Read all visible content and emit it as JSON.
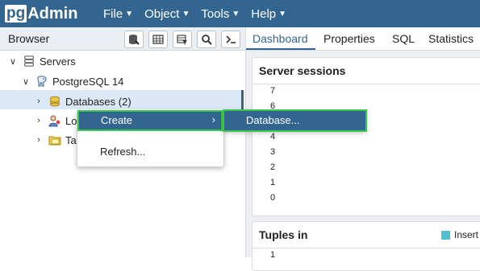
{
  "app": {
    "logo_pg": "pg",
    "logo_admin": "Admin"
  },
  "menu": [
    {
      "label": "File"
    },
    {
      "label": "Object"
    },
    {
      "label": "Tools"
    },
    {
      "label": "Help"
    }
  ],
  "browser": {
    "title": "Browser",
    "toolbar_icons": [
      "query-tool-icon",
      "view-data-icon",
      "filtered-rows-icon",
      "search-icon",
      "psql-tool-icon"
    ],
    "tree": [
      {
        "label": "Servers",
        "icon": "servers-icon",
        "expanded": true
      },
      {
        "label": "PostgreSQL 14",
        "icon": "postgresql-elephant-icon",
        "expanded": true
      },
      {
        "label": "Databases (2)",
        "icon": "database-icon",
        "expanded": false,
        "selected": true
      },
      {
        "label": "Lo",
        "icon": "login-roles-icon",
        "expanded": false
      },
      {
        "label": "Ta",
        "icon": "tablespaces-icon",
        "expanded": false
      }
    ]
  },
  "tabs": [
    {
      "label": "Dashboard",
      "active": true
    },
    {
      "label": "Properties"
    },
    {
      "label": "SQL"
    },
    {
      "label": "Statistics"
    }
  ],
  "dashboard": {
    "server_sessions": {
      "title": "Server sessions",
      "yticks": [
        "7",
        "6",
        "5",
        "4",
        "3",
        "2",
        "1",
        "0"
      ]
    },
    "tuples_in": {
      "title": "Tuples in",
      "legend": "Insert",
      "legend_color": "#4fc1d1",
      "yticks": [
        "1"
      ]
    }
  },
  "context_menu": {
    "create": "Create",
    "create_arrow": "›",
    "refresh": "Refresh...",
    "submenu": {
      "database": "Database..."
    },
    "highlight_color": "#3cc64a"
  },
  "colors": {
    "brand": "#326690",
    "selected_row": "#dbe8f5"
  }
}
